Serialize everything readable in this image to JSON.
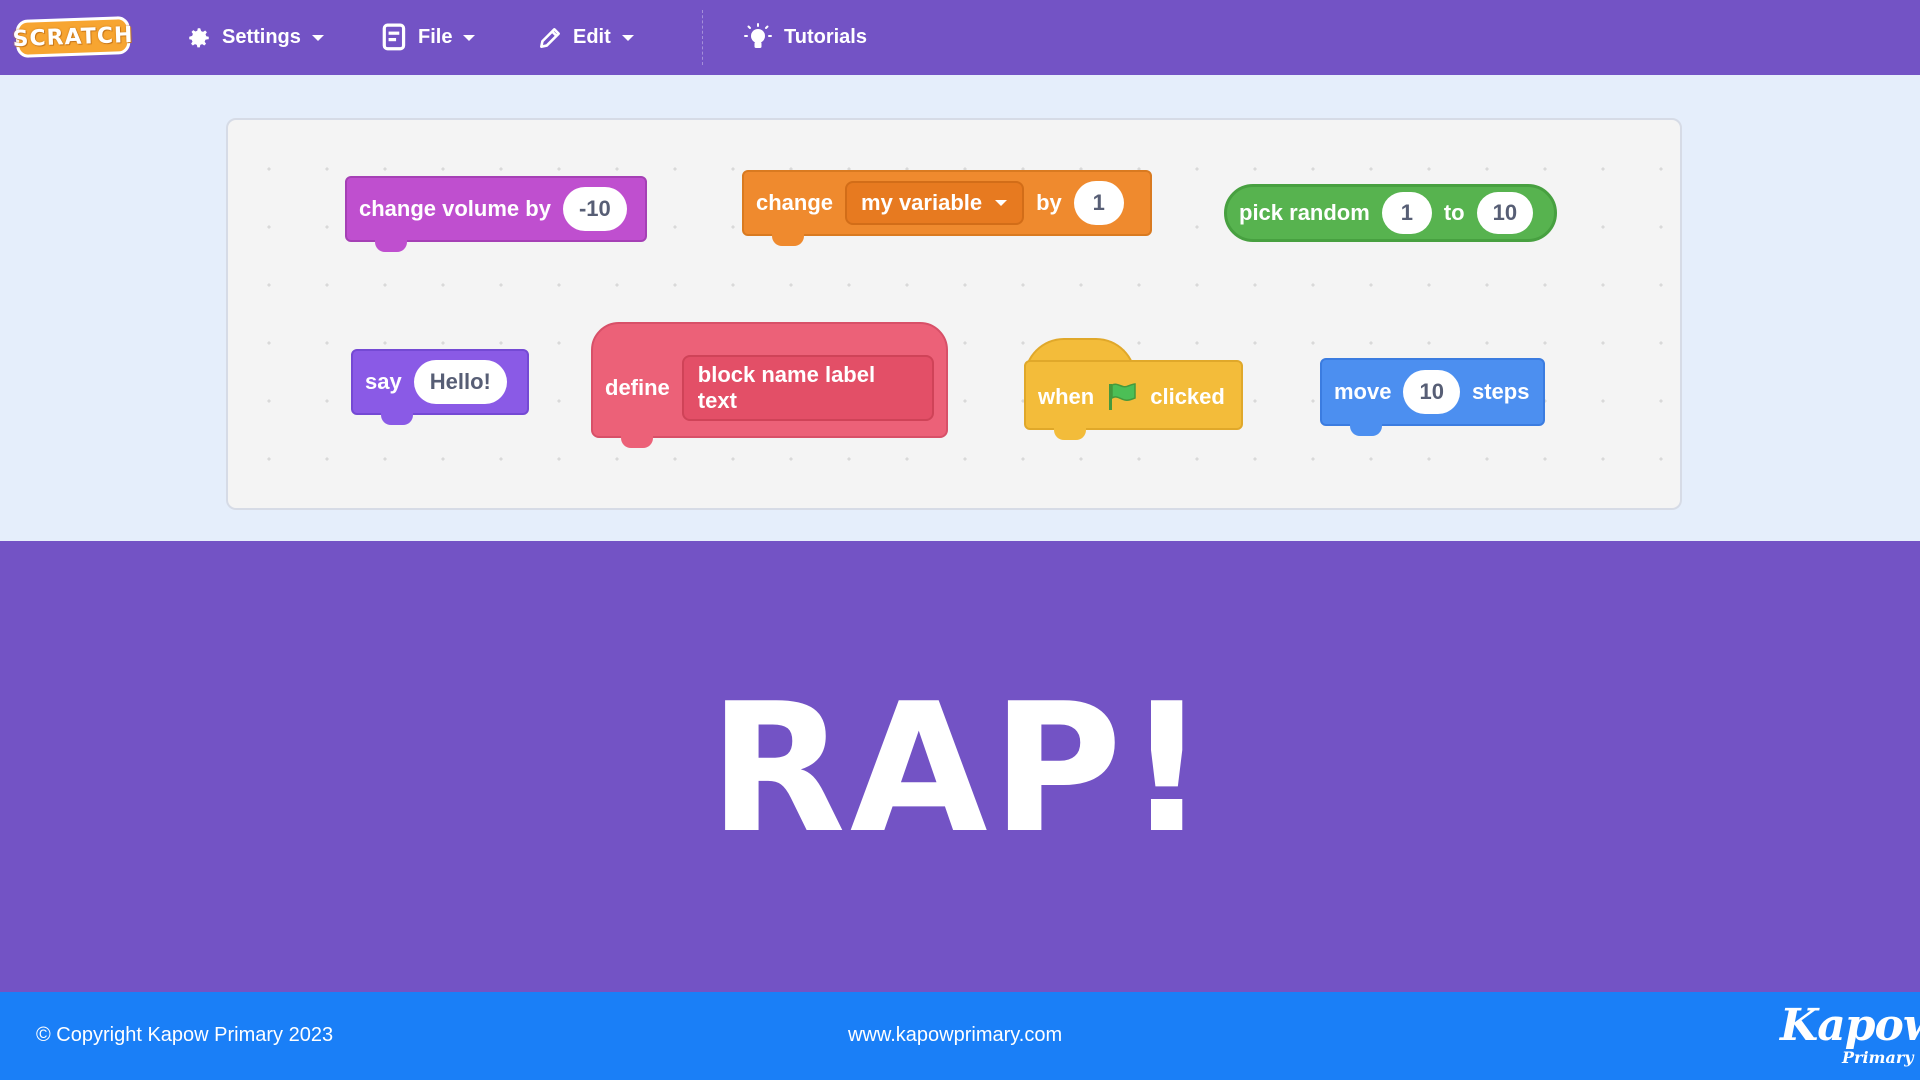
{
  "menubar": {
    "logo_text": "SCRATCH",
    "settings_label": "Settings",
    "file_label": "File",
    "edit_label": "Edit",
    "tutorials_label": "Tutorials"
  },
  "blocks": {
    "volume": {
      "text": "change volume by",
      "value": "-10"
    },
    "change_var": {
      "text_before": "change",
      "variable": "my variable",
      "text_by": "by",
      "value": "1"
    },
    "random": {
      "text": "pick random",
      "from": "1",
      "to_text": "to",
      "to": "10"
    },
    "say": {
      "text": "say",
      "value": "Hello!"
    },
    "define": {
      "text": "define",
      "label": "block name label text"
    },
    "hat": {
      "when": "when",
      "clicked": "clicked"
    },
    "move": {
      "text": "move",
      "value": "10",
      "steps": "steps"
    }
  },
  "hero": {
    "title": "RAP!"
  },
  "footer": {
    "copyright": "©  Copyright Kapow Primary 2023",
    "website": "www.kapowprimary.com",
    "brand_main": "Kapow",
    "brand_sub": "Primary"
  },
  "colors": {
    "menubar": "#7353c5",
    "footer": "#1a7ff7",
    "looks": "#8a5ae6",
    "sound": "#bf4fcf",
    "variables": "#ef8a2e",
    "operators": "#57b34f",
    "events": "#f3bc3a",
    "motion": "#4c8ff0",
    "my_blocks": "#ec6178"
  },
  "icons": [
    "gear-icon",
    "file-icon",
    "pencil-icon",
    "lightbulb-icon",
    "flag-icon",
    "chevron-down-icon"
  ]
}
